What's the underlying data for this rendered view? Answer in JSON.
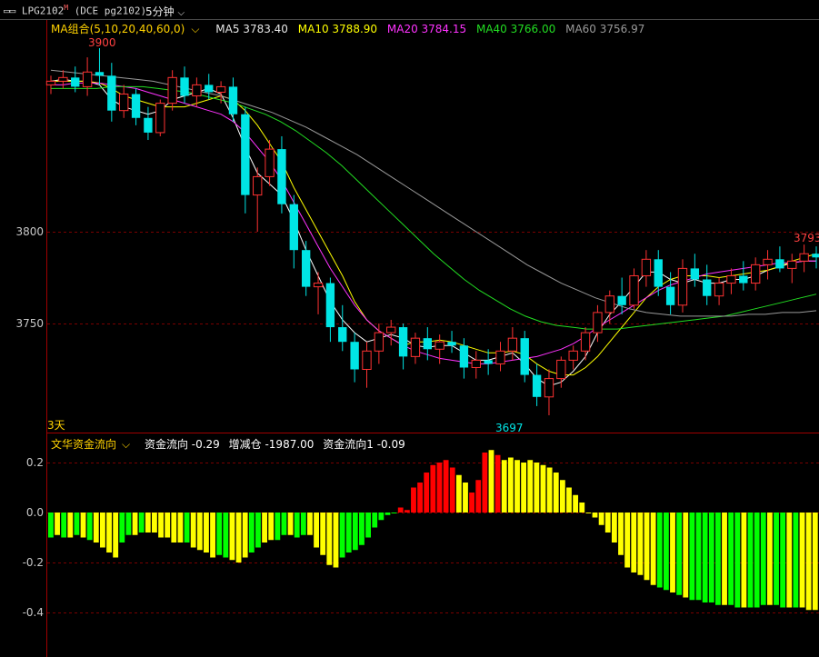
{
  "header": {
    "symbol_text": "LPG2102",
    "symbol_mark": "M",
    "symbol_detail": "(DCE pg2102)",
    "timeframe": "5分钟",
    "dropdown_icon": "chevron-down-icon",
    "window_icon": "restore-window-icon"
  },
  "ma_legend": {
    "group_label": "MA组合(5,10,20,40,60,0)",
    "items": [
      {
        "label": "MA5 3783.40",
        "color": "#ffffff"
      },
      {
        "label": "MA10 3788.90",
        "color": "#ffff00"
      },
      {
        "label": "MA20 3784.15",
        "color": "#ff33ff"
      },
      {
        "label": "MA40 3766.00",
        "color": "#22dd22"
      },
      {
        "label": "MA60 3756.97",
        "color": "#999999"
      }
    ]
  },
  "price_axis": {
    "ticks": [
      "3800",
      "3750"
    ],
    "range": [
      3690,
      3915
    ]
  },
  "annotations": {
    "high": "3900",
    "low": "3697",
    "last_high": "3793",
    "day_marker": "3天"
  },
  "indicator": {
    "name": "文华资金流向",
    "values": [
      {
        "label": "资金流向 -0.29",
        "color": "#ffffff"
      },
      {
        "label": "增减仓 -1987.00",
        "color": "#ffffff"
      },
      {
        "label": "资金流向1 -0.09",
        "color": "#ffffff"
      }
    ],
    "ticks": [
      "0.2",
      "0.0",
      "-0.2",
      "-0.4"
    ]
  },
  "colors": {
    "up": "#ff3232",
    "down": "#00e5e5",
    "grid": "#7a0000",
    "axis": "#a00000",
    "green": "#00ff00",
    "yellow": "#ffff00",
    "red": "#ff0000"
  },
  "chart_data": [
    {
      "type": "candlestick",
      "title": "LPG2102 5分钟",
      "ylim": [
        3690,
        3915
      ],
      "ohlc": [
        [
          3880,
          3885,
          3875,
          3882
        ],
        [
          3882,
          3888,
          3878,
          3884
        ],
        [
          3884,
          3890,
          3876,
          3879
        ],
        [
          3879,
          3895,
          3874,
          3887
        ],
        [
          3887,
          3900,
          3880,
          3885
        ],
        [
          3885,
          3892,
          3860,
          3866
        ],
        [
          3866,
          3880,
          3862,
          3875
        ],
        [
          3875,
          3878,
          3858,
          3862
        ],
        [
          3862,
          3868,
          3850,
          3854
        ],
        [
          3854,
          3872,
          3852,
          3870
        ],
        [
          3870,
          3888,
          3866,
          3884
        ],
        [
          3884,
          3890,
          3870,
          3874
        ],
        [
          3874,
          3884,
          3868,
          3880
        ],
        [
          3880,
          3886,
          3872,
          3876
        ],
        [
          3876,
          3882,
          3870,
          3879
        ],
        [
          3879,
          3884,
          3860,
          3864
        ],
        [
          3864,
          3868,
          3810,
          3820
        ],
        [
          3820,
          3835,
          3800,
          3830
        ],
        [
          3830,
          3850,
          3825,
          3845
        ],
        [
          3845,
          3852,
          3810,
          3815
        ],
        [
          3815,
          3820,
          3780,
          3790
        ],
        [
          3790,
          3795,
          3765,
          3770
        ],
        [
          3770,
          3778,
          3755,
          3772
        ],
        [
          3772,
          3775,
          3740,
          3748
        ],
        [
          3748,
          3760,
          3735,
          3740
        ],
        [
          3740,
          3745,
          3718,
          3725
        ],
        [
          3725,
          3740,
          3715,
          3735
        ],
        [
          3735,
          3750,
          3728,
          3745
        ],
        [
          3745,
          3752,
          3738,
          3748
        ],
        [
          3748,
          3750,
          3725,
          3732
        ],
        [
          3732,
          3745,
          3728,
          3742
        ],
        [
          3742,
          3748,
          3730,
          3736
        ],
        [
          3736,
          3744,
          3728,
          3740
        ],
        [
          3740,
          3746,
          3734,
          3738
        ],
        [
          3738,
          3742,
          3720,
          3726
        ],
        [
          3726,
          3735,
          3720,
          3730
        ],
        [
          3730,
          3736,
          3722,
          3728
        ],
        [
          3728,
          3740,
          3724,
          3735
        ],
        [
          3735,
          3748,
          3730,
          3742
        ],
        [
          3742,
          3746,
          3718,
          3722
        ],
        [
          3722,
          3728,
          3705,
          3710
        ],
        [
          3710,
          3725,
          3700,
          3720
        ],
        [
          3720,
          3732,
          3715,
          3730
        ],
        [
          3730,
          3738,
          3725,
          3735
        ],
        [
          3735,
          3748,
          3730,
          3745
        ],
        [
          3745,
          3760,
          3740,
          3756
        ],
        [
          3756,
          3768,
          3750,
          3765
        ],
        [
          3765,
          3775,
          3755,
          3760
        ],
        [
          3760,
          3780,
          3758,
          3776
        ],
        [
          3776,
          3790,
          3770,
          3785
        ],
        [
          3785,
          3790,
          3765,
          3770
        ],
        [
          3770,
          3778,
          3755,
          3760
        ],
        [
          3760,
          3785,
          3756,
          3780
        ],
        [
          3780,
          3788,
          3770,
          3774
        ],
        [
          3774,
          3782,
          3760,
          3765
        ],
        [
          3765,
          3775,
          3760,
          3772
        ],
        [
          3772,
          3780,
          3766,
          3776
        ],
        [
          3776,
          3784,
          3768,
          3772
        ],
        [
          3772,
          3786,
          3768,
          3782
        ],
        [
          3782,
          3790,
          3774,
          3785
        ],
        [
          3785,
          3792,
          3778,
          3780
        ],
        [
          3780,
          3788,
          3772,
          3784
        ],
        [
          3784,
          3793,
          3778,
          3788
        ],
        [
          3788,
          3792,
          3780,
          3786
        ]
      ],
      "series": [
        {
          "name": "MA5",
          "values": [
            3882,
            3883,
            3882,
            3882,
            3880,
            3872,
            3868,
            3866,
            3864,
            3866,
            3872,
            3874,
            3876,
            3878,
            3875,
            3862,
            3846,
            3832,
            3826,
            3820,
            3806,
            3790,
            3776,
            3762,
            3752,
            3745,
            3740,
            3742,
            3744,
            3742,
            3738,
            3737,
            3738,
            3738,
            3734,
            3730,
            3730,
            3732,
            3734,
            3728,
            3720,
            3716,
            3718,
            3724,
            3732,
            3745,
            3755,
            3762,
            3770,
            3778,
            3778,
            3774,
            3772,
            3774,
            3772,
            3772,
            3774,
            3774,
            3776,
            3779,
            3781,
            3783,
            3784,
            3784
          ]
        },
        {
          "name": "MA10",
          "values": [
            3882,
            3882,
            3882,
            3882,
            3881,
            3878,
            3874,
            3872,
            3870,
            3868,
            3868,
            3868,
            3870,
            3872,
            3874,
            3872,
            3866,
            3858,
            3848,
            3838,
            3824,
            3812,
            3800,
            3788,
            3776,
            3762,
            3752,
            3746,
            3742,
            3738,
            3740,
            3740,
            3741,
            3740,
            3738,
            3736,
            3734,
            3734,
            3735,
            3733,
            3728,
            3724,
            3722,
            3722,
            3726,
            3732,
            3740,
            3748,
            3756,
            3764,
            3770,
            3774,
            3776,
            3776,
            3776,
            3775,
            3776,
            3777,
            3778,
            3779,
            3781,
            3784,
            3786,
            3788
          ]
        },
        {
          "name": "MA20",
          "values": [
            3880,
            3880,
            3881,
            3881,
            3881,
            3880,
            3879,
            3878,
            3876,
            3874,
            3872,
            3870,
            3868,
            3866,
            3864,
            3860,
            3854,
            3846,
            3838,
            3828,
            3816,
            3804,
            3792,
            3780,
            3770,
            3760,
            3752,
            3746,
            3742,
            3738,
            3735,
            3733,
            3731,
            3730,
            3729,
            3728,
            3728,
            3729,
            3730,
            3731,
            3732,
            3734,
            3736,
            3739,
            3743,
            3748,
            3752,
            3756,
            3760,
            3764,
            3768,
            3771,
            3773,
            3775,
            3777,
            3778,
            3779,
            3780,
            3781,
            3782,
            3783,
            3783,
            3784,
            3784
          ]
        },
        {
          "name": "MA40",
          "values": [
            3878,
            3878,
            3878,
            3878,
            3879,
            3879,
            3879,
            3878,
            3877,
            3876,
            3874,
            3872,
            3870,
            3867,
            3864,
            3860,
            3855,
            3849,
            3843,
            3836,
            3828,
            3820,
            3812,
            3804,
            3796,
            3788,
            3781,
            3774,
            3768,
            3763,
            3758,
            3754,
            3751,
            3749,
            3748,
            3747,
            3747,
            3747,
            3748,
            3749,
            3750,
            3751,
            3752,
            3753,
            3754,
            3756,
            3758,
            3760,
            3762,
            3764,
            3766
          ]
        },
        {
          "name": "MA60",
          "values": [
            3888,
            3887,
            3886,
            3885,
            3884,
            3883,
            3882,
            3880,
            3878,
            3876,
            3874,
            3871,
            3868,
            3865,
            3861,
            3857,
            3852,
            3847,
            3842,
            3836,
            3830,
            3824,
            3818,
            3812,
            3806,
            3800,
            3794,
            3788,
            3782,
            3777,
            3772,
            3768,
            3764,
            3761,
            3758,
            3756,
            3755,
            3754,
            3754,
            3754,
            3754,
            3755,
            3755,
            3756,
            3756,
            3757
          ]
        }
      ]
    },
    {
      "type": "bar",
      "title": "文华资金流向",
      "ylim": [
        -0.42,
        0.25
      ],
      "values": [
        -0.1,
        -0.09,
        -0.1,
        -0.1,
        -0.09,
        -0.1,
        -0.11,
        -0.12,
        -0.14,
        -0.16,
        -0.18,
        -0.12,
        -0.09,
        -0.09,
        -0.08,
        -0.08,
        -0.08,
        -0.1,
        -0.1,
        -0.12,
        -0.12,
        -0.12,
        -0.14,
        -0.15,
        -0.16,
        -0.18,
        -0.17,
        -0.18,
        -0.19,
        -0.2,
        -0.18,
        -0.16,
        -0.14,
        -0.12,
        -0.11,
        -0.11,
        -0.09,
        -0.09,
        -0.1,
        -0.09,
        -0.09,
        -0.14,
        -0.17,
        -0.21,
        -0.22,
        -0.18,
        -0.16,
        -0.15,
        -0.13,
        -0.1,
        -0.06,
        -0.03,
        -0.01,
        0,
        0.02,
        0.01,
        0.1,
        0.12,
        0.16,
        0.19,
        0.2,
        0.21,
        0.18,
        0.15,
        0.12,
        0.08,
        0.13,
        0.24,
        0.25,
        0.23,
        0.21,
        0.22,
        0.21,
        0.2,
        0.21,
        0.2,
        0.19,
        0.18,
        0.16,
        0.13,
        0.1,
        0.07,
        0.04,
        0,
        -0.02,
        -0.05,
        -0.08,
        -0.12,
        -0.17,
        -0.22,
        -0.24,
        -0.25,
        -0.27,
        -0.29,
        -0.3,
        -0.31,
        -0.32,
        -0.33,
        -0.34,
        -0.35,
        -0.35,
        -0.36,
        -0.36,
        -0.37,
        -0.37,
        -0.37,
        -0.38,
        -0.38,
        -0.38,
        -0.38,
        -0.37,
        -0.37,
        -0.37,
        -0.38,
        -0.38,
        -0.38,
        -0.38,
        -0.39,
        -0.39
      ],
      "colors": [
        "#00ff00",
        "#ffff00",
        "#00ff00",
        "#ffff00",
        "#00ff00",
        "#ffff00",
        "#00ff00",
        "#ffff00",
        "#ffff00",
        "#ffff00",
        "#ffff00",
        "#00ff00",
        "#00ff00",
        "#ffff00",
        "#00ff00",
        "#ffff00",
        "#ffff00",
        "#ffff00",
        "#ffff00",
        "#ffff00",
        "#ffff00",
        "#00ff00",
        "#ffff00",
        "#ffff00",
        "#ffff00",
        "#ffff00",
        "#00ff00",
        "#00ff00",
        "#ffff00",
        "#ffff00",
        "#ffff00",
        "#00ff00",
        "#00ff00",
        "#ffff00",
        "#ffff00",
        "#00ff00",
        "#00ff00",
        "#ffff00",
        "#00ff00",
        "#00ff00",
        "#ffff00",
        "#ffff00",
        "#ffff00",
        "#ffff00",
        "#ffff00",
        "#00ff00",
        "#00ff00",
        "#00ff00",
        "#00ff00",
        "#00ff00",
        "#00ff00",
        "#00ff00",
        "#00ff00",
        "#00ff00",
        "#ff0000",
        "#ff0000",
        "#ff0000",
        "#ff0000",
        "#ff0000",
        "#ff0000",
        "#ff0000",
        "#ff0000",
        "#ff0000",
        "#ffff00",
        "#ffff00",
        "#ff0000",
        "#ff0000",
        "#ff0000",
        "#ffff00",
        "#ff0000",
        "#ffff00",
        "#ffff00",
        "#ffff00",
        "#ffff00",
        "#ffff00",
        "#ffff00",
        "#ffff00",
        "#ffff00",
        "#ffff00",
        "#ffff00",
        "#ffff00",
        "#ffff00",
        "#ffff00",
        "#ffff00",
        "#ffff00",
        "#ffff00",
        "#ffff00",
        "#ffff00",
        "#ffff00",
        "#ffff00",
        "#ffff00",
        "#ffff00",
        "#ffff00",
        "#ffff00",
        "#00ff00",
        "#00ff00",
        "#ffff00",
        "#00ff00",
        "#ffff00",
        "#00ff00",
        "#00ff00",
        "#00ff00",
        "#00ff00",
        "#00ff00",
        "#ffff00",
        "#00ff00",
        "#00ff00",
        "#ffff00",
        "#00ff00",
        "#00ff00",
        "#00ff00",
        "#ffff00",
        "#00ff00",
        "#00ff00",
        "#ffff00",
        "#00ff00",
        "#ffff00",
        "#ffff00",
        "#ffff00"
      ]
    }
  ]
}
